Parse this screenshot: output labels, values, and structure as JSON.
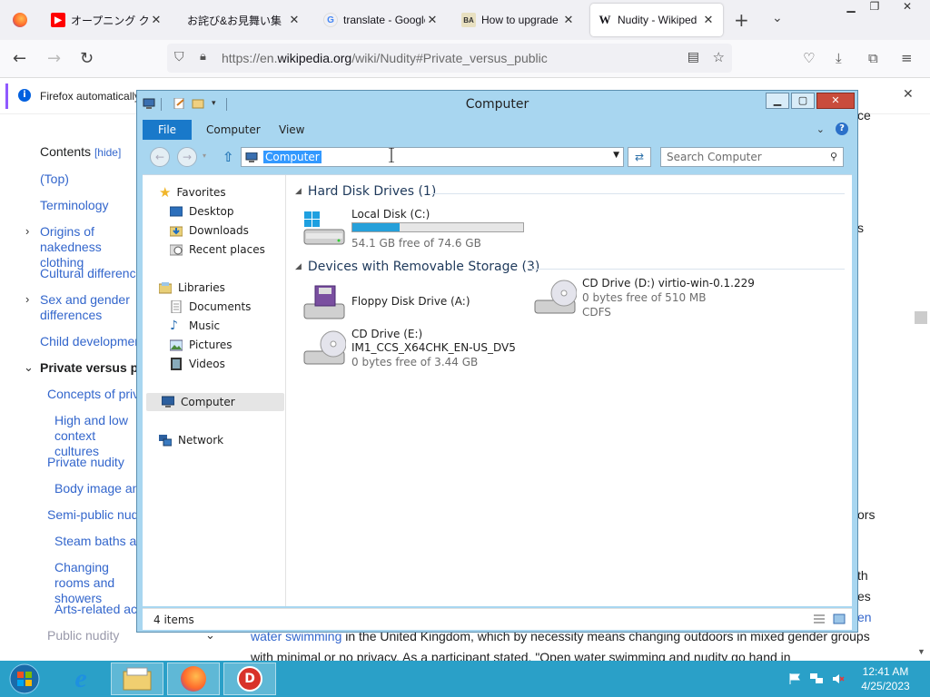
{
  "browser": {
    "tabs": [
      {
        "title": "オープニング ク",
        "favicon": "youtube-icon"
      },
      {
        "title": "お詫び&お見舞い集",
        "favicon": "none"
      },
      {
        "title": "translate - Google",
        "favicon": "google-icon"
      },
      {
        "title": "How to upgrade",
        "favicon": "site-icon"
      },
      {
        "title": "Nudity - Wikiped",
        "favicon": "wikipedia-icon",
        "active": true
      }
    ],
    "url": {
      "scheme": "https://en.",
      "host": "wikipedia.org",
      "path": "/wiki/Nudity#Private_versus_public"
    },
    "notice": "Firefox automatically"
  },
  "wiki": {
    "toc_title": "Contents",
    "toc_hide": "[hide]",
    "toc_items": [
      "(Top)",
      "Terminology",
      "Origins of nakedness clothing",
      "Cultural differences",
      "Sex and gender differences",
      "Child development",
      "Private versus public",
      "Concepts of private",
      "High and low context cultures",
      "Private nudity",
      "Body image and",
      "Semi-public nudity",
      "Steam baths and",
      "Changing rooms and showers",
      "Arts-related activities",
      "Public nudity"
    ],
    "body_link": "water swimming",
    "body_line1": " in the United Kingdom, which by necessity means changing outdoors in mixed gender groups",
    "body_line2": "with minimal or no privacy. As a participant stated, \"Open water swimming and nudity go hand in",
    "frag_s": "s",
    "frag_ors": "ors",
    "frag_th": "th",
    "frag_es": "es",
    "frag_en": "en",
    "frag_ce": "ce"
  },
  "explorer": {
    "title": "Computer",
    "ribbon_tabs": [
      "File",
      "Computer",
      "View"
    ],
    "address": "Computer",
    "search_placeholder": "Search Computer",
    "nav": {
      "favorites_label": "Favorites",
      "favorites": [
        "Desktop",
        "Downloads",
        "Recent places"
      ],
      "libraries_label": "Libraries",
      "libraries": [
        "Documents",
        "Music",
        "Pictures",
        "Videos"
      ],
      "computer": "Computer",
      "network": "Network"
    },
    "groups": {
      "hard_disks": "Hard Disk Drives (1)",
      "removable": "Devices with Removable Storage (3)"
    },
    "drives": {
      "c": {
        "name": "Local Disk (C:)",
        "space": "54.1 GB free of 74.6 GB",
        "used_fraction": 0.275
      },
      "a": {
        "name": "Floppy Disk Drive (A:)"
      },
      "d": {
        "name": "CD Drive (D:) virtio-win-0.1.229",
        "space": "0 bytes free of 510 MB",
        "fs": "CDFS"
      },
      "e": {
        "name": "CD Drive (E:)",
        "label": "IM1_CCS_X64CHK_EN-US_DV5",
        "space": "0 bytes free of 3.44 GB"
      }
    },
    "status": "4 items"
  },
  "taskbar": {
    "time": "12:41 AM",
    "date": "4/25/2023"
  },
  "colors": {
    "taskbar": "#2aa0c8",
    "window_frame": "#a8d6f0",
    "file_tab": "#1979ca",
    "selection": "#3399ff",
    "link": "#3366cc",
    "drive_bar": "#26a0da"
  }
}
